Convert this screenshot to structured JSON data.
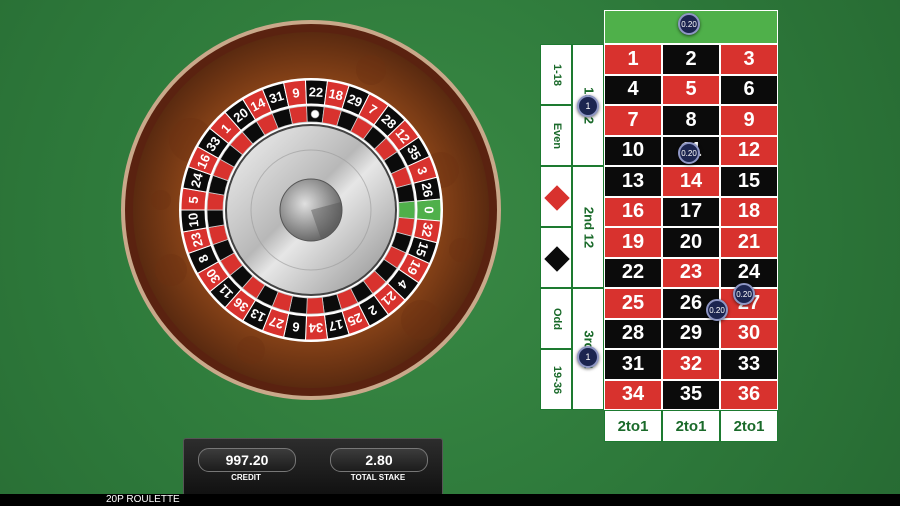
{
  "game_title": "20P ROULETTE",
  "wheel": {
    "numbers": [
      0,
      32,
      15,
      19,
      4,
      21,
      2,
      25,
      17,
      34,
      6,
      27,
      13,
      36,
      11,
      30,
      8,
      23,
      10,
      5,
      24,
      16,
      33,
      1,
      20,
      14,
      31,
      9,
      22,
      18,
      29,
      7,
      28,
      12,
      35,
      3,
      26
    ],
    "ball_number": 22
  },
  "table": {
    "zero_label": "",
    "zero_chip": "0.20",
    "rows": [
      [
        {
          "n": "1",
          "c": "red"
        },
        {
          "n": "2",
          "c": "black"
        },
        {
          "n": "3",
          "c": "red"
        }
      ],
      [
        {
          "n": "4",
          "c": "black"
        },
        {
          "n": "5",
          "c": "red"
        },
        {
          "n": "6",
          "c": "black"
        }
      ],
      [
        {
          "n": "7",
          "c": "red"
        },
        {
          "n": "8",
          "c": "black"
        },
        {
          "n": "9",
          "c": "red"
        }
      ],
      [
        {
          "n": "10",
          "c": "black"
        },
        {
          "n": "11",
          "c": "black"
        },
        {
          "n": "12",
          "c": "red"
        }
      ],
      [
        {
          "n": "13",
          "c": "black"
        },
        {
          "n": "14",
          "c": "red"
        },
        {
          "n": "15",
          "c": "black"
        }
      ],
      [
        {
          "n": "16",
          "c": "red"
        },
        {
          "n": "17",
          "c": "black"
        },
        {
          "n": "18",
          "c": "red"
        }
      ],
      [
        {
          "n": "19",
          "c": "red"
        },
        {
          "n": "20",
          "c": "black"
        },
        {
          "n": "21",
          "c": "red"
        }
      ],
      [
        {
          "n": "22",
          "c": "black"
        },
        {
          "n": "23",
          "c": "red"
        },
        {
          "n": "24",
          "c": "black"
        }
      ],
      [
        {
          "n": "25",
          "c": "red"
        },
        {
          "n": "26",
          "c": "black"
        },
        {
          "n": "27",
          "c": "red"
        }
      ],
      [
        {
          "n": "28",
          "c": "black"
        },
        {
          "n": "29",
          "c": "black"
        },
        {
          "n": "30",
          "c": "red"
        }
      ],
      [
        {
          "n": "31",
          "c": "black"
        },
        {
          "n": "32",
          "c": "red"
        },
        {
          "n": "33",
          "c": "black"
        }
      ],
      [
        {
          "n": "34",
          "c": "red"
        },
        {
          "n": "35",
          "c": "black"
        },
        {
          "n": "36",
          "c": "red"
        }
      ]
    ],
    "outside": {
      "low": "1-18",
      "even": "Even",
      "odd": "Odd",
      "high": "19-36",
      "dozen1": "1st 12",
      "dozen2": "2nd 12",
      "dozen3": "3rd 12"
    },
    "columns": [
      "2to1",
      "2to1",
      "2to1"
    ],
    "chips": {
      "dozen1": "1",
      "dozen3": "1",
      "split_11": "0.20",
      "corner_26": "0.20",
      "corner_24": "0.20"
    }
  },
  "panel": {
    "credit_value": "997.20",
    "credit_label": "CREDIT",
    "stake_value": "2.80",
    "stake_label": "TOTAL STAKE"
  },
  "colors": {
    "felt": "#2e7a3b",
    "red": "#d8322e",
    "black": "#0b0b0b",
    "green": "#4fb04a",
    "wood": "#7a3c18"
  }
}
